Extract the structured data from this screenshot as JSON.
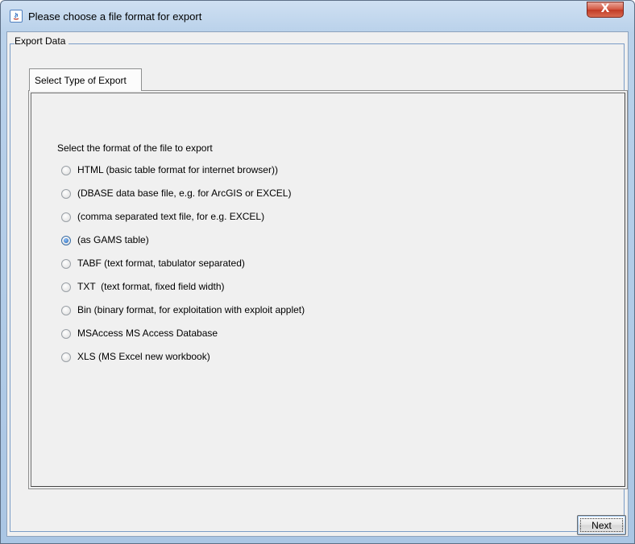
{
  "window": {
    "title": "Please choose a file format for export",
    "close_label": "X"
  },
  "group": {
    "legend": "Export Data"
  },
  "tabs": [
    {
      "label": "Select Type of Export",
      "selected": true
    }
  ],
  "panel": {
    "prompt": "Select the format of the file to export",
    "options": [
      {
        "label": "HTML (basic table format for internet browser))",
        "checked": false
      },
      {
        "label": "(DBASE data base file, e.g. for ArcGIS or EXCEL)",
        "checked": false
      },
      {
        "label": "(comma separated text file, for e.g. EXCEL)",
        "checked": false
      },
      {
        "label": "(as GAMS table)",
        "checked": true
      },
      {
        "label": "TABF (text format, tabulator separated)",
        "checked": false
      },
      {
        "label": "TXT  (text format, fixed field width)",
        "checked": false
      },
      {
        "label": "Bin (binary format, for exploitation with exploit applet)",
        "checked": false
      },
      {
        "label": "MSAccess MS Access Database",
        "checked": false
      },
      {
        "label": "XLS (MS Excel new workbook)",
        "checked": false
      }
    ]
  },
  "buttons": {
    "next_label": "Next"
  },
  "colors": {
    "title_bar": "#b9d1ea",
    "close_button": "#c13a24",
    "dialog_background": "#f0f0f0",
    "radio_selected": "#1f5fa8"
  }
}
